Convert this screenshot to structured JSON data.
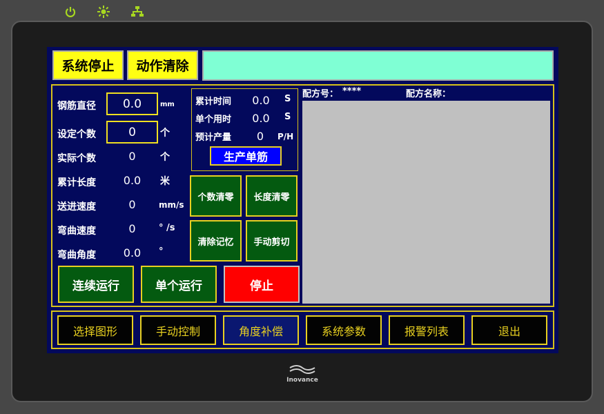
{
  "header": {
    "system_stop": "系统停止",
    "action_clear": "动作清除",
    "message": ""
  },
  "params": [
    {
      "label": "钢筋直径",
      "value": "0.0",
      "unit": "mm"
    },
    {
      "label": "设定个数",
      "value": "0",
      "unit": "个"
    },
    {
      "label": "实际个数",
      "value": "0",
      "unit": "个"
    },
    {
      "label": "累计长度",
      "value": "0.0",
      "unit": "米"
    },
    {
      "label": "送进速度",
      "value": "0",
      "unit": "mm/s"
    },
    {
      "label": "弯曲速度",
      "value": "0",
      "unit": "° /s"
    },
    {
      "label": "弯曲角度",
      "value": "0.0",
      "unit": "°"
    }
  ],
  "stats": [
    {
      "label": "累计时间",
      "value": "0.0",
      "unit": "S"
    },
    {
      "label": "单个用时",
      "value": "0.0",
      "unit": "S"
    },
    {
      "label": "预计产量",
      "value": "0",
      "unit": "P/H"
    }
  ],
  "produce_single": "生产单筋",
  "buttons": {
    "count_clear": "个数清零",
    "length_clear": "长度清零",
    "memory_clear": "清除记忆",
    "manual_cut": "手动剪切",
    "continuous_run": "连续运行",
    "single_run": "单个运行",
    "stop": "停止"
  },
  "recipe": {
    "number_label": "配方号：",
    "number_value": "****",
    "name_label": "配方名称："
  },
  "nav": [
    "选择图形",
    "手动控制",
    "角度补偿",
    "系统参数",
    "报警列表",
    "退出"
  ],
  "brand": "Inovance",
  "colors": {
    "screen_bg": "#03095c",
    "yellow": "#ffff14",
    "mint": "#7fffd4",
    "green_btn": "#045a10",
    "stop_red": "#ff0000",
    "preview_grey": "#c0c0c0"
  },
  "icons": [
    "power-icon",
    "sun-icon",
    "network-icon"
  ]
}
